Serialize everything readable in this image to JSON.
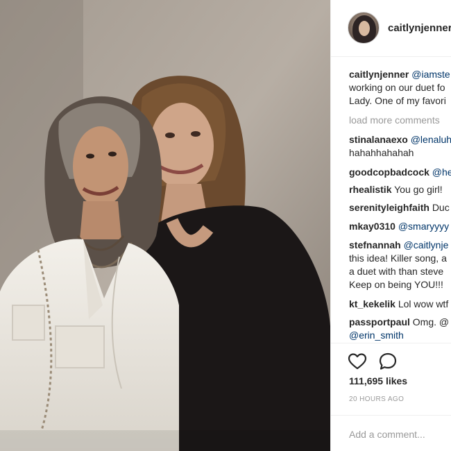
{
  "post": {
    "username": "caitlynjenner",
    "photo_alt": "",
    "colors": {
      "mention": "#003569",
      "muted": "#999999",
      "text": "#262626",
      "divider": "#efefef"
    }
  },
  "caption": {
    "username": "caitlynjenner",
    "mention": "@iamste",
    "line2": "working on our duet fo",
    "line3": "Lady. One of my favori"
  },
  "load_more": "load more comments",
  "comments": [
    {
      "username": "stinalanaexo",
      "mention": "@lenaluh",
      "text": "",
      "continuation": "hahahhahahah"
    },
    {
      "username": "goodcopbadcock",
      "mention": "@he",
      "text": ""
    },
    {
      "username": "rhealistik",
      "mention": "",
      "text": "You go girl!"
    },
    {
      "username": "serenityleighfaith",
      "mention": "",
      "text": "Duc"
    },
    {
      "username": "mkay0310",
      "mention": "@smaryyyy",
      "text": ""
    },
    {
      "username": "stefnannah",
      "mention": "@caitlynje",
      "text": "",
      "continuation_lines": [
        "this idea! Killer song, a",
        "a duet with than steve",
        "Keep on being YOU!!!"
      ]
    },
    {
      "username": "kt_kekelik",
      "mention": "",
      "text": "Lol wow wtf"
    },
    {
      "username": "passportpaul",
      "mention": "",
      "text": "Omg. @",
      "continuation_mention": "@erin_smith"
    }
  ],
  "actions": {
    "like_icon": "heart-outline-icon",
    "comment_icon": "speech-bubble-icon"
  },
  "likes": "111,695 likes",
  "timestamp": "20 HOURS AGO",
  "add_comment_placeholder": "Add a comment..."
}
